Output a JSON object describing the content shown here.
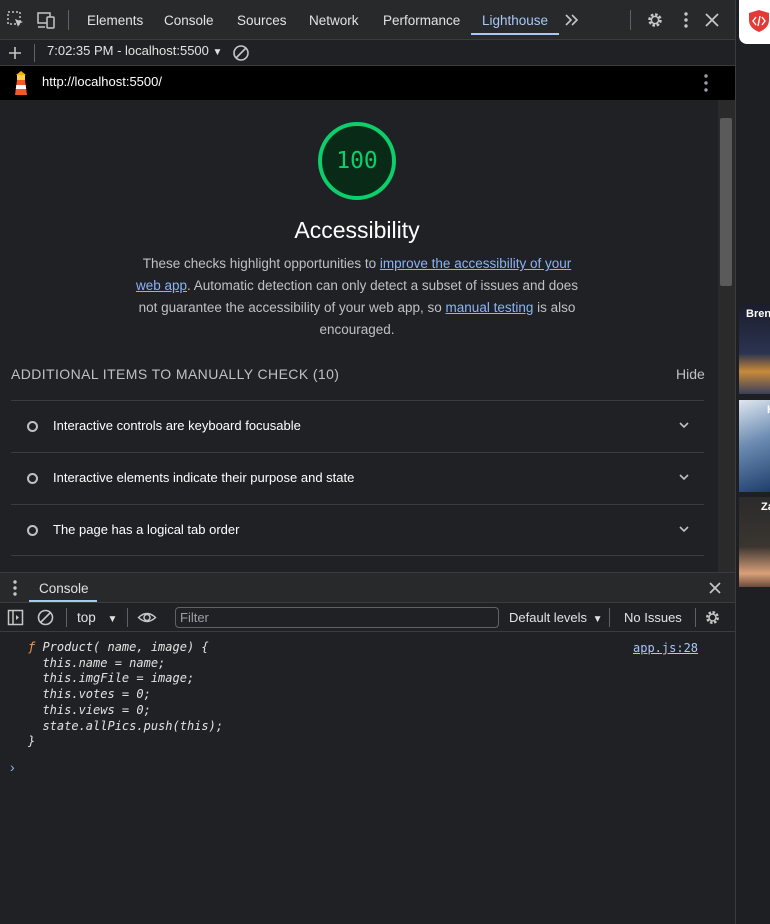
{
  "tabs": [
    {
      "label": "Elements"
    },
    {
      "label": "Console"
    },
    {
      "label": "Sources"
    },
    {
      "label": "Network"
    },
    {
      "label": "Performance"
    },
    {
      "label": "Lighthouse",
      "active": true
    }
  ],
  "report_toolbar": {
    "report_select": "7:02:35 PM - localhost:5500"
  },
  "url": "http://localhost:5500/",
  "category": {
    "score": "100",
    "title": "Accessibility",
    "description_parts": {
      "p1": "These checks highlight opportunities to ",
      "link1": "improve the accessibility of your web app",
      "p2": ". Automatic detection can only detect a subset of issues and does not guarantee the accessibility of your web app, so ",
      "link2": "manual testing",
      "p3": " is also encouraged."
    },
    "manual_section": {
      "heading": "ADDITIONAL ITEMS TO MANUALLY CHECK (10)",
      "hide_label": "Hide",
      "items": [
        {
          "label": "Interactive controls are keyboard focusable"
        },
        {
          "label": "Interactive elements indicate their purpose and state"
        },
        {
          "label": "The page has a logical tab order"
        }
      ]
    }
  },
  "drawer": {
    "tab": "Console",
    "context": "top",
    "filter_placeholder": "Filter",
    "levels": "Default levels",
    "issues": "No Issues"
  },
  "console_output": {
    "lines": [
      "Product( name, image) {",
      "  this.name = name;",
      "  this.imgFile = image;",
      "  this.votes = 0;",
      "  this.views = 0;",
      "  state.allPics.push(this);",
      "}"
    ],
    "fn_keyword": "ƒ ",
    "source_link": "app.js:28",
    "prompt": "›"
  },
  "side_thumbnails": [
    {
      "name": "Brend"
    },
    {
      "name": "H"
    },
    {
      "name": "Za"
    }
  ],
  "colors": {
    "score_green": "#0cce6b",
    "link_blue": "#8ab4f8",
    "active_tab": "#a8c7fa",
    "fn_orange": "#f29b4d"
  }
}
